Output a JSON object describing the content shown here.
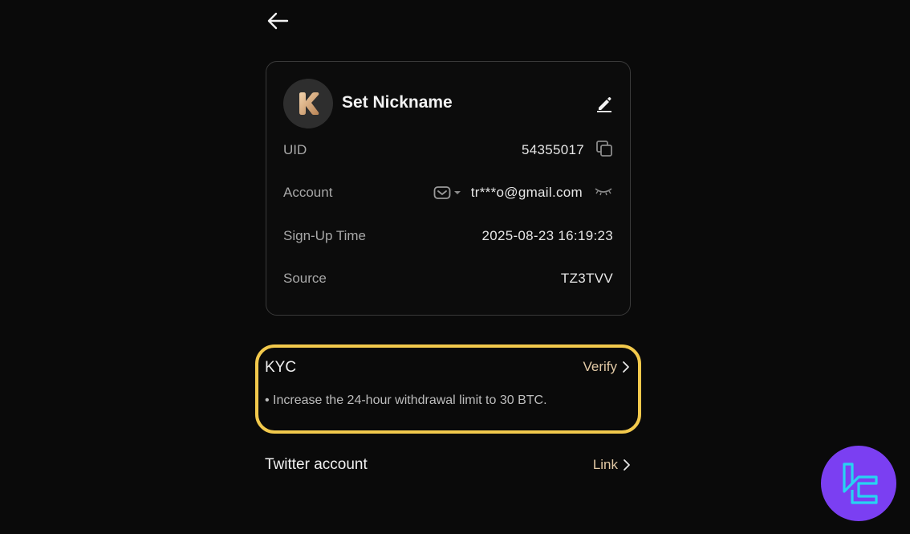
{
  "nav": {
    "back_icon": "arrow-left-icon"
  },
  "profile": {
    "avatar_letter": "K",
    "nickname": "Set Nickname",
    "edit_icon": "pencil-icon",
    "rows": [
      {
        "label": "UID",
        "value": "54355017",
        "icon": "copy-icon"
      },
      {
        "label": "Account",
        "value": "tr***o@gmail.com",
        "icon": "eye-closed-icon",
        "prefix_icon": "mail-icon"
      },
      {
        "label": "Sign-Up Time",
        "value": "2025-08-23 16:19:23"
      },
      {
        "label": "Source",
        "value": "TZ3TVV"
      }
    ]
  },
  "kyc": {
    "title": "KYC",
    "action": "Verify",
    "description": "• Increase the 24-hour withdrawal limit to 30 BTC.",
    "highlight_color": "#f2c94c"
  },
  "twitter": {
    "label": "Twitter account",
    "action": "Link"
  },
  "colors": {
    "background": "#0a0a0a",
    "accent": "#e2c9a5",
    "watermark": "#7b3ff2"
  }
}
